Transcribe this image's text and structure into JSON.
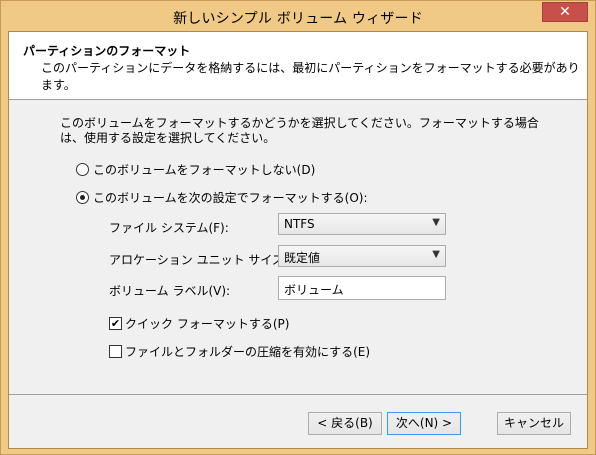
{
  "window": {
    "title": "新しいシンプル ボリューム ウィザード",
    "close_glyph": "✕"
  },
  "header": {
    "title": "パーティションのフォーマット",
    "subtitle": "このパーティションにデータを格納するには、最初にパーティションをフォーマットする必要があります。"
  },
  "intro": "このボリュームをフォーマットするかどうかを選択してください。フォーマットする場合は、使用する設定を選択してください。",
  "options": {
    "no_format": {
      "label": "このボリュームをフォーマットしない(D)",
      "checked": false
    },
    "format": {
      "label": "このボリュームを次の設定でフォーマットする(O):",
      "checked": true
    }
  },
  "fields": {
    "filesystem_label": "ファイル システム(F):",
    "filesystem_value": "NTFS",
    "allocation_label": "アロケーション ユニット サイズ(A):",
    "allocation_value": "既定値",
    "volume_label_label": "ボリューム ラベル(V):",
    "volume_label_value": "ボリューム"
  },
  "checks": {
    "quick_format": {
      "label": "クイック フォーマットする(P)",
      "checked": true
    },
    "compression": {
      "label": "ファイルとフォルダーの圧縮を有効にする(E)",
      "checked": false
    }
  },
  "buttons": {
    "back": "< 戻る(B)",
    "next": "次へ(N) >",
    "cancel": "キャンセル"
  }
}
